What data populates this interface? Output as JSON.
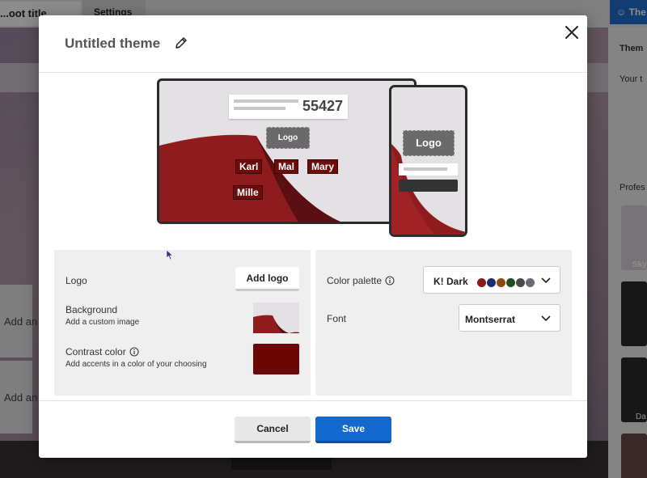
{
  "background_app": {
    "title_input": "...oot title...",
    "settings_button": "Settings",
    "theme_button": "The",
    "card_text_1": "Add an",
    "card_text_2": "Add an",
    "right_panel_title": "Them",
    "right_panel_label_1": "Your t",
    "right_panel_label_2": "Profes",
    "right_panel_thumb_1": "Sky",
    "right_panel_thumb_2": "Da"
  },
  "modal": {
    "title": "Untitled theme",
    "edit_icon": "pencil-icon",
    "close_icon": "close-icon",
    "preview": {
      "game_pin": "55427",
      "logo_text": "Logo",
      "players": [
        "Karl",
        "Mal",
        "Mary",
        "Mille"
      ],
      "carousel_count": 3,
      "carousel_active_index": 0
    },
    "logo": {
      "label": "Logo",
      "button": "Add logo"
    },
    "background": {
      "label": "Background",
      "hint": "Add a custom image"
    },
    "contrast": {
      "label": "Contrast color",
      "hint": "Add accents in a color of your choosing",
      "color": "#6c0707"
    },
    "palette": {
      "label": "Color palette",
      "selected": "K! Dark",
      "swatches": [
        "#8c1a1a",
        "#1d2a6b",
        "#8a4a12",
        "#1f4d1f",
        "#4a4a4a",
        "#6b6b78"
      ]
    },
    "font": {
      "label": "Font",
      "selected": "Montserrat"
    },
    "footer": {
      "cancel": "Cancel",
      "save": "Save"
    }
  },
  "colors": {
    "accent_blue": "#1368ce",
    "dark_red": "#6c0707",
    "panel_gray": "#efefef"
  }
}
